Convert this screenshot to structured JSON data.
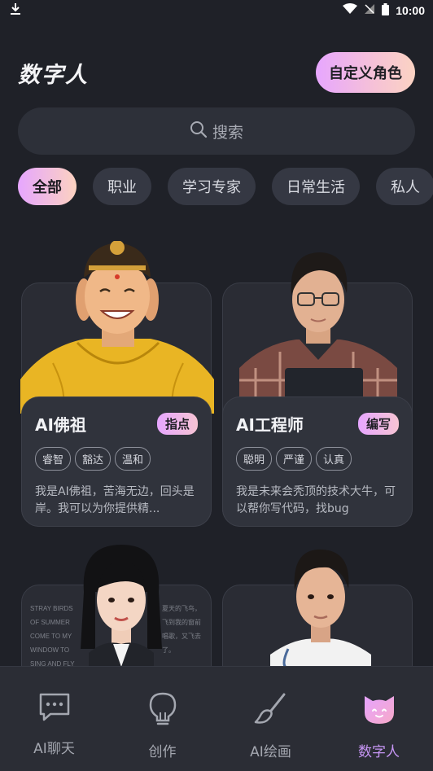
{
  "status_bar": {
    "time": "10:00"
  },
  "header": {
    "title": "数字人",
    "custom_button": "自定义角色"
  },
  "search": {
    "placeholder": "搜索"
  },
  "categories": [
    "全部",
    "职业",
    "学习专家",
    "日常生活",
    "私人"
  ],
  "cards": [
    {
      "name": "AI佛祖",
      "role": "指点",
      "traits": [
        "睿智",
        "豁达",
        "温和"
      ],
      "description": "我是AI佛祖，苦海无边，回头是岸。我可以为你提供精..."
    },
    {
      "name": "AI工程师",
      "role": "编写",
      "traits": [
        "聪明",
        "严谨",
        "认真"
      ],
      "description": "我是未来会秃顶的技术大牛，可以帮你写代码，找bug"
    }
  ],
  "poster_text": {
    "left": [
      "STRAY BIRDS",
      "OF SUMMER",
      "COME TO MY",
      "WINDOW TO",
      "SING AND FLY"
    ],
    "right": [
      "夏天的飞鸟，",
      "飞到我的窗前",
      "唱歌，又飞去",
      "了。"
    ]
  },
  "bottom_nav": [
    {
      "label": "AI聊天",
      "icon": "chat-icon"
    },
    {
      "label": "创作",
      "icon": "lightbulb-icon"
    },
    {
      "label": "AI绘画",
      "icon": "paintbrush-icon"
    },
    {
      "label": "数字人",
      "icon": "digital-human-icon"
    }
  ],
  "colors": {
    "accent": "#c796f5",
    "background": "#1f2128"
  }
}
